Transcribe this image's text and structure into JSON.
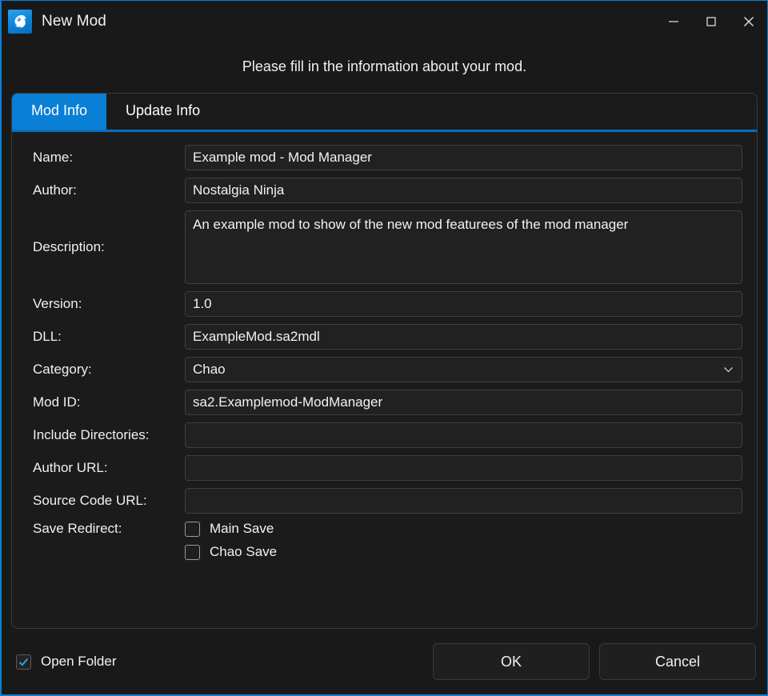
{
  "window": {
    "title": "New Mod",
    "icon": "sonic-head-icon",
    "accent_color": "#0a7fd6",
    "background_color": "#191919",
    "controls": {
      "minimize": "minimize-icon",
      "maximize": "maximize-icon",
      "close": "close-icon"
    }
  },
  "subtitle": "Please fill in the information about your mod.",
  "tabs": [
    {
      "label": "Mod Info",
      "active": true
    },
    {
      "label": "Update Info",
      "active": false
    }
  ],
  "form": {
    "name": {
      "label": "Name:",
      "value": "Example mod - Mod Manager",
      "placeholder": ""
    },
    "author": {
      "label": "Author:",
      "value": "Nostalgia Ninja",
      "placeholder": ""
    },
    "description": {
      "label": "Description:",
      "value": "An example mod to show of the new mod featurees of the mod manager",
      "placeholder": ""
    },
    "version": {
      "label": "Version:",
      "value": "1.0",
      "placeholder": ""
    },
    "dll": {
      "label": "DLL:",
      "value": "ExampleMod.sa2mdl",
      "placeholder": ""
    },
    "category": {
      "label": "Category:",
      "value": "Chao",
      "arrow_icon": "chevron-down-icon"
    },
    "mod_id": {
      "label": "Mod ID:",
      "value": "sa2.Examplemod-ModManager",
      "placeholder": ""
    },
    "include_directories": {
      "label": "Include Directories:",
      "value": "",
      "placeholder": ""
    },
    "author_url": {
      "label": "Author URL:",
      "value": "",
      "placeholder": ""
    },
    "source_code_url": {
      "label": "Source Code URL:",
      "value": "",
      "placeholder": ""
    },
    "save_redirect": {
      "label": "Save Redirect:",
      "options": [
        {
          "label": "Main Save",
          "checked": false
        },
        {
          "label": "Chao Save",
          "checked": false
        }
      ]
    }
  },
  "footer": {
    "open_folder": {
      "label": "Open Folder",
      "checked": true
    },
    "ok_label": "OK",
    "cancel_label": "Cancel"
  }
}
